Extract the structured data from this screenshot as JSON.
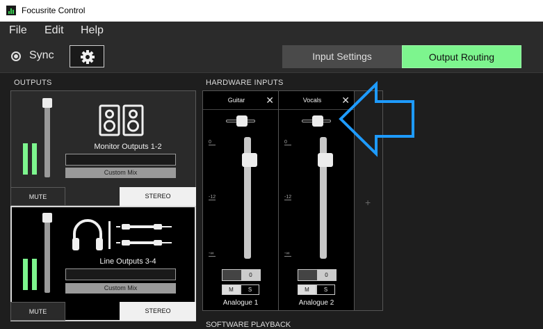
{
  "window": {
    "title": "Focusrite Control"
  },
  "menu": {
    "items": [
      "File",
      "Edit",
      "Help"
    ]
  },
  "toolbar": {
    "sync_label": "Sync",
    "settings_icon": "gear-icon",
    "tabs": [
      {
        "label": "Input Settings",
        "active": false
      },
      {
        "label": "Output Routing",
        "active": true
      }
    ]
  },
  "outputs": {
    "section_label": "OUTPUTS",
    "cards": [
      {
        "name": "Monitor Outputs 1-2",
        "mix": "Custom Mix",
        "mute_label": "MUTE",
        "stereo_label": "STEREO",
        "icon": "speakers-icon"
      },
      {
        "name": "Line Outputs 3-4",
        "mix": "Custom Mix",
        "mute_label": "MUTE",
        "stereo_label": "STEREO",
        "icon": "headphones-and-jacks-icon"
      }
    ]
  },
  "hardware_inputs": {
    "section_label": "HARDWARE INPUTS",
    "channels": [
      {
        "name": "Guitar",
        "footer": "Analogue 1",
        "gain": "0",
        "mute": "M",
        "solo": "S",
        "db_marks": [
          "0",
          "-12",
          "-∞"
        ]
      },
      {
        "name": "Vocals",
        "footer": "Analogue 2",
        "gain": "0",
        "mute": "M",
        "solo": "S",
        "db_marks": [
          "0",
          "-12",
          "-∞"
        ]
      }
    ],
    "add_label": "+"
  },
  "bottom_section": {
    "label": "SOFTWARE PLAYBACK"
  },
  "colors": {
    "accent": "#7df58e",
    "arrow": "#1e9bff"
  }
}
